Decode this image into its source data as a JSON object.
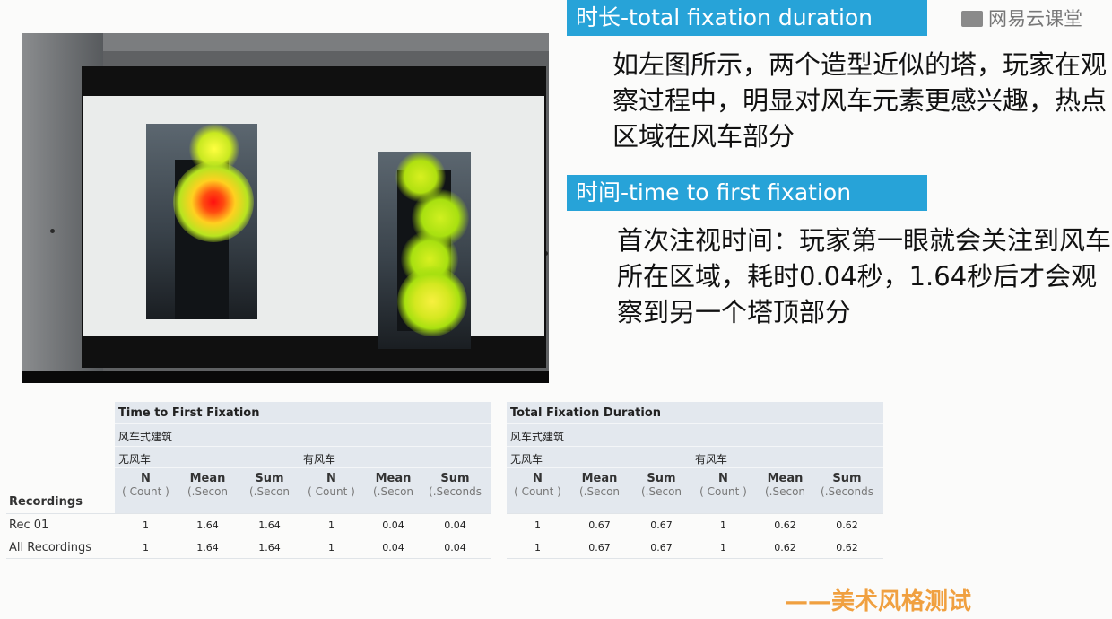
{
  "headers": {
    "duration": "时长-total fixation duration",
    "first_fixation": "时间-time to first fixation"
  },
  "logo": {
    "text": "网易云课堂"
  },
  "paragraphs": {
    "duration": "如左图所示，两个造型近似的塔，玩家在观察过程中，明显对风车元素更感兴趣，热点区域在风车部分",
    "first_fixation": "首次注视时间：玩家第一眼就会关注到风车所在区域，耗时0.04秒，1.64秒后才会观察到另一个塔顶部分"
  },
  "tables": {
    "first": {
      "title": "Time to First Fixation",
      "group": "风车式建筑",
      "sub_a": "无风车",
      "sub_b": "有风车"
    },
    "second": {
      "title": "Total Fixation Duration",
      "group": "风车式建筑",
      "sub_a": "无风车",
      "sub_b": "有风车"
    },
    "columns": {
      "n": "N",
      "n_unit": "( Count )",
      "mean": "Mean",
      "mean_unit": "(.Secon",
      "sum": "Sum",
      "sum_unit": "(.Secon",
      "sum_unit_last": "(.Seconds"
    },
    "recordings_label": "Recordings",
    "rows": [
      {
        "label": "Rec 01",
        "first": [
          "1",
          "1.64",
          "1.64",
          "1",
          "0.04",
          "0.04"
        ],
        "second": [
          "1",
          "0.67",
          "0.67",
          "1",
          "0.62",
          "0.62"
        ]
      },
      {
        "label": "All Recordings",
        "first": [
          "1",
          "1.64",
          "1.64",
          "1",
          "0.04",
          "0.04"
        ],
        "second": [
          "1",
          "0.67",
          "0.67",
          "1",
          "0.62",
          "0.62"
        ]
      }
    ]
  },
  "footer": "——美术风格测试",
  "colors": {
    "accent": "#27a3d8",
    "footer": "#f0a040"
  }
}
